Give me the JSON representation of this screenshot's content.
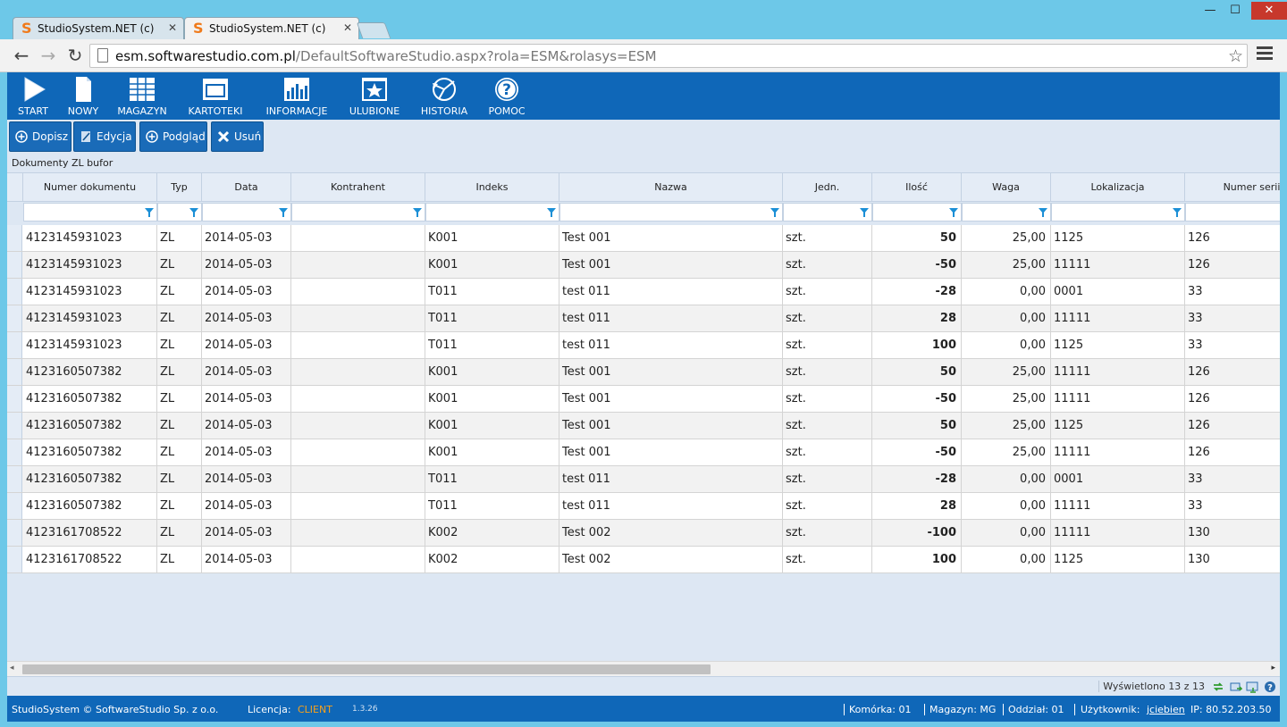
{
  "browser": {
    "tabs": [
      {
        "title": "StudioSystem.NET (c) Softw",
        "active": false
      },
      {
        "title": "StudioSystem.NET (c) Softw",
        "active": true
      }
    ],
    "url_host": "esm.softwarestudio.com.pl",
    "url_path": "/DefaultSoftwareStudio.aspx?rola=ESM&rolasys=ESM",
    "close_glyph": "✕",
    "minimize_glyph": "—",
    "maximize_glyph": "☐",
    "back_glyph": "←",
    "forward_glyph": "→",
    "reload_glyph": "↻",
    "star_glyph": "☆"
  },
  "menu": [
    {
      "label": "START",
      "icon": "play-icon"
    },
    {
      "label": "NOWY",
      "icon": "new-document-icon"
    },
    {
      "label": "MAGAZYN",
      "icon": "warehouse-grid-icon"
    },
    {
      "label": "KARTOTEKI",
      "icon": "window-icon"
    },
    {
      "label": "INFORMACJE",
      "icon": "bar-chart-icon"
    },
    {
      "label": "ULUBIONE",
      "icon": "star-icon"
    },
    {
      "label": "HISTORIA",
      "icon": "history-icon"
    },
    {
      "label": "POMOC",
      "icon": "help-icon"
    }
  ],
  "actions": [
    {
      "label": "Dopisz",
      "icon": "plus-circle-icon"
    },
    {
      "label": "Edycja",
      "icon": "edit-icon"
    },
    {
      "label": "Podgląd",
      "icon": "plus-circle-icon"
    },
    {
      "label": "Usuń",
      "icon": "delete-x-icon"
    }
  ],
  "grid": {
    "caption": "Dokumenty ZL bufor",
    "columns": [
      "Numer dokumentu",
      "Typ",
      "Data",
      "Kontrahent",
      "Indeks",
      "Nazwa",
      "Jedn.",
      "Ilość",
      "Waga",
      "Lokalizacja",
      "Numer serii"
    ],
    "rows": [
      [
        "4123145931023",
        "ZL",
        "2014-05-03",
        "",
        "K001",
        "Test 001",
        "szt.",
        "50",
        "25,00",
        "1125",
        "126"
      ],
      [
        "4123145931023",
        "ZL",
        "2014-05-03",
        "",
        "K001",
        "Test 001",
        "szt.",
        "-50",
        "25,00",
        "11111",
        "126"
      ],
      [
        "4123145931023",
        "ZL",
        "2014-05-03",
        "",
        "T011",
        "test 011",
        "szt.",
        "-28",
        "0,00",
        "0001",
        "33"
      ],
      [
        "4123145931023",
        "ZL",
        "2014-05-03",
        "",
        "T011",
        "test 011",
        "szt.",
        "28",
        "0,00",
        "11111",
        "33"
      ],
      [
        "4123145931023",
        "ZL",
        "2014-05-03",
        "",
        "T011",
        "test 011",
        "szt.",
        "100",
        "0,00",
        "1125",
        "33"
      ],
      [
        "4123160507382",
        "ZL",
        "2014-05-03",
        "",
        "K001",
        "Test 001",
        "szt.",
        "50",
        "25,00",
        "11111",
        "126"
      ],
      [
        "4123160507382",
        "ZL",
        "2014-05-03",
        "",
        "K001",
        "Test 001",
        "szt.",
        "-50",
        "25,00",
        "11111",
        "126"
      ],
      [
        "4123160507382",
        "ZL",
        "2014-05-03",
        "",
        "K001",
        "Test 001",
        "szt.",
        "50",
        "25,00",
        "1125",
        "126"
      ],
      [
        "4123160507382",
        "ZL",
        "2014-05-03",
        "",
        "K001",
        "Test 001",
        "szt.",
        "-50",
        "25,00",
        "11111",
        "126"
      ],
      [
        "4123160507382",
        "ZL",
        "2014-05-03",
        "",
        "T011",
        "test 011",
        "szt.",
        "-28",
        "0,00",
        "0001",
        "33"
      ],
      [
        "4123160507382",
        "ZL",
        "2014-05-03",
        "",
        "T011",
        "test 011",
        "szt.",
        "28",
        "0,00",
        "11111",
        "33"
      ],
      [
        "4123161708522",
        "ZL",
        "2014-05-03",
        "",
        "K002",
        "Test 002",
        "szt.",
        "-100",
        "0,00",
        "11111",
        "130"
      ],
      [
        "4123161708522",
        "ZL",
        "2014-05-03",
        "",
        "K002",
        "Test 002",
        "szt.",
        "100",
        "0,00",
        "1125",
        "130"
      ]
    ],
    "pager_text": "Wyświetlono 13 z 13",
    "scroll_left_glyph": "◂",
    "scroll_right_glyph": "▸"
  },
  "status": {
    "company": "StudioSystem © SoftwareStudio Sp. z o.o.",
    "license_label": "Licencja:",
    "license_value": "CLIENT",
    "version": "1.3.26",
    "cell": "Komórka: 01",
    "warehouse": "Magazyn: MG",
    "branch": "Oddział: 01",
    "user_label": "Użytkownik:",
    "user_value": "jciebien",
    "ip": "IP: 80.52.203.50"
  },
  "colors": {
    "accent": "#0f67b8",
    "panel": "#dde7f3",
    "license": "#f7a11a"
  }
}
